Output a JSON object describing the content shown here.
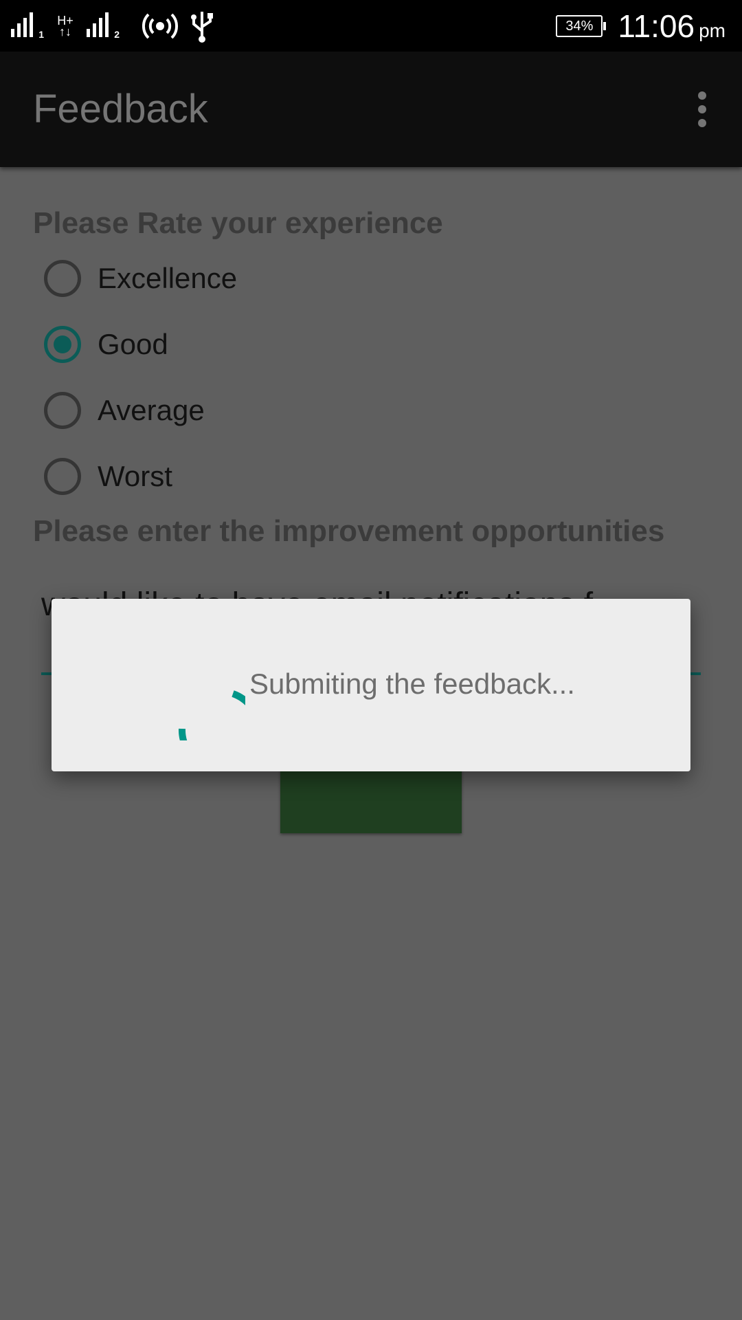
{
  "status_bar": {
    "sim1_index": "1",
    "sim2_index": "2",
    "network_type": "H+",
    "icons": [
      "signal-sim1-icon",
      "data-arrows-icon",
      "signal-sim2-icon",
      "hotspot-icon",
      "usb-icon",
      "battery-icon"
    ],
    "battery": "34%",
    "time": "11:06",
    "ampm": "pm"
  },
  "app_bar": {
    "title": "Feedback",
    "overflow_icon": "more-vert-icon"
  },
  "form": {
    "rating_heading": "Please Rate your experience",
    "options": [
      {
        "label": "Excellence",
        "checked": false
      },
      {
        "label": "Good",
        "checked": true
      },
      {
        "label": "Average",
        "checked": false
      },
      {
        "label": "Worst",
        "checked": false
      }
    ],
    "improvement_heading": "Please enter the improvement opportunities",
    "improvement_text": "would like to have email notifications f"
  },
  "dialog": {
    "message": "Submiting the feedback..."
  },
  "colors": {
    "accent": "#009688",
    "radio_checked": "#0b5c57",
    "button": "#1f3f20",
    "scrim": "#5f5f5f"
  }
}
